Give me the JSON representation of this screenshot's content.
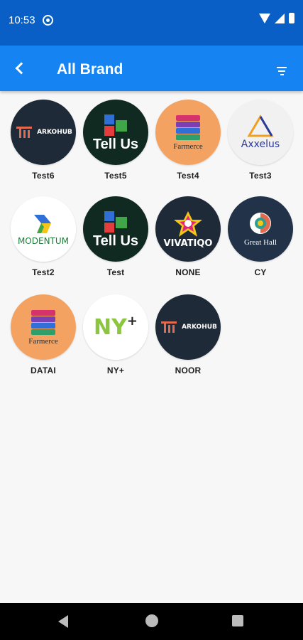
{
  "status_bar": {
    "time": "10:53"
  },
  "app_bar": {
    "title": "All Brand"
  },
  "brands": [
    {
      "name": "Test6",
      "logo": "arkohub",
      "logo_text": "ARKOHUB"
    },
    {
      "name": "Test5",
      "logo": "tellus",
      "logo_text": "Tell Us"
    },
    {
      "name": "Test4",
      "logo": "farmerce",
      "logo_text": "Farmerce"
    },
    {
      "name": "Test3",
      "logo": "axxelus",
      "logo_text": "Axxelus"
    },
    {
      "name": "Test2",
      "logo": "modentum",
      "logo_text": "MODENTUM"
    },
    {
      "name": "Test",
      "logo": "tellus",
      "logo_text": "Tell Us"
    },
    {
      "name": "NONE",
      "logo": "vivatiqo",
      "logo_text": "VIVATIQO"
    },
    {
      "name": "CY",
      "logo": "greathall",
      "logo_text": "Great Hall"
    },
    {
      "name": "DATAI",
      "logo": "farmerce",
      "logo_text": "Farmerce"
    },
    {
      "name": "NY+",
      "logo": "nyplus",
      "logo_text": "NY"
    },
    {
      "name": "NOOR",
      "logo": "arkohub",
      "logo_text": "ARKOHUB"
    }
  ],
  "colors": {
    "status_bar": "#0a5fc7",
    "app_bar": "#1683f3",
    "background": "#f7f7f7"
  }
}
